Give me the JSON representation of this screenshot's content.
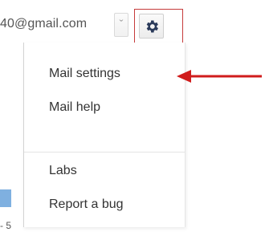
{
  "header": {
    "account_email": "40@gmail.com",
    "dropdown_arrow": "ˇ",
    "settings_icon": "gear-icon"
  },
  "settings_menu": {
    "items": [
      {
        "label": "Mail settings"
      },
      {
        "label": "Mail help"
      },
      {
        "label": "Labs"
      },
      {
        "label": "Report a bug"
      }
    ]
  },
  "background": {
    "fragment_text": "- 5"
  },
  "colors": {
    "highlight_border": "#c63b3b",
    "annotation_arrow": "#d01c1c",
    "gear": "#2a3a5a"
  }
}
